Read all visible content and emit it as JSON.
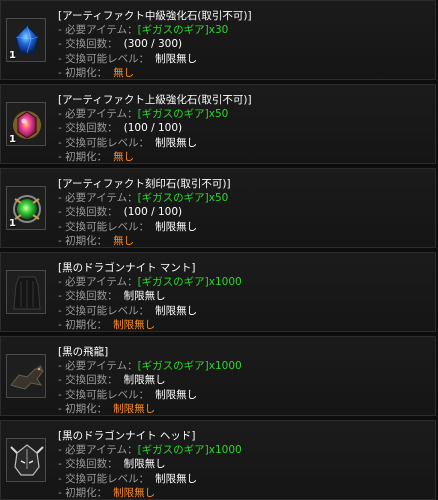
{
  "items": [
    {
      "name": "[アーティファクト中級強化石(取引不可)]",
      "required_label": "- 必要アイテム：",
      "required_item": "[ギガスのギア]",
      "required_qty": "x30",
      "count_label": "- 交換回数：",
      "count_value": "(300 / 300)",
      "level_label": "- 交換可能レベル：",
      "level_value": "制限無し",
      "reset_label": "- 初期化：",
      "reset_value": "無し",
      "stack": "1",
      "icon": "blue-gem-icon"
    },
    {
      "name": "[アーティファクト上級強化石(取引不可)]",
      "required_label": "- 必要アイテム：",
      "required_item": "[ギガスのギア]",
      "required_qty": "x50",
      "count_label": "- 交換回数：",
      "count_value": "(100 / 100)",
      "level_label": "- 交換可能レベル：",
      "level_value": "制限無し",
      "reset_label": "- 初期化：",
      "reset_value": "無し",
      "stack": "1",
      "icon": "red-gem-icon"
    },
    {
      "name": "[アーティファクト刻印石(取引不可)]",
      "required_label": "- 必要アイテム：",
      "required_item": "[ギガスのギア]",
      "required_qty": "x50",
      "count_label": "- 交換回数：",
      "count_value": "(100 / 100)",
      "level_label": "- 交換可能レベル：",
      "level_value": "制限無し",
      "reset_label": "- 初期化：",
      "reset_value": "無し",
      "stack": "1",
      "icon": "green-orb-icon"
    },
    {
      "name": "[黒のドラゴンナイト マント]",
      "required_label": "- 必要アイテム：",
      "required_item": "[ギガスのギア]",
      "required_qty": "x1000",
      "count_label": "- 交換回数：",
      "count_value": "制限無し",
      "level_label": "- 交換可能レベル：",
      "level_value": "制限無し",
      "reset_label": "- 初期化：",
      "reset_value": "制限無し",
      "stack": "",
      "icon": "black-cloak-icon"
    },
    {
      "name": "[黒の飛龍]",
      "required_label": "- 必要アイテム：",
      "required_item": "[ギガスのギア]",
      "required_qty": "x1000",
      "count_label": "- 交換回数：",
      "count_value": "制限無し",
      "level_label": "- 交換可能レベル：",
      "level_value": "制限無し",
      "reset_label": "- 初期化：",
      "reset_value": "制限無し",
      "stack": "",
      "icon": "black-wyvern-icon"
    },
    {
      "name": "[黒のドラゴンナイト ヘッド]",
      "required_label": "- 必要アイテム：",
      "required_item": "[ギガスのギア]",
      "required_qty": "x1000",
      "count_label": "- 交換回数：",
      "count_value": "制限無し",
      "level_label": "- 交換可能レベル：",
      "level_value": "制限無し",
      "reset_label": "- 初期化：",
      "reset_value": "制限無し",
      "stack": "",
      "icon": "dragon-helmet-icon"
    }
  ],
  "colors": {
    "item_link": "#29d929",
    "value": "#ffffff",
    "reset": "#ff8a24",
    "label": "#9a9a9a"
  }
}
